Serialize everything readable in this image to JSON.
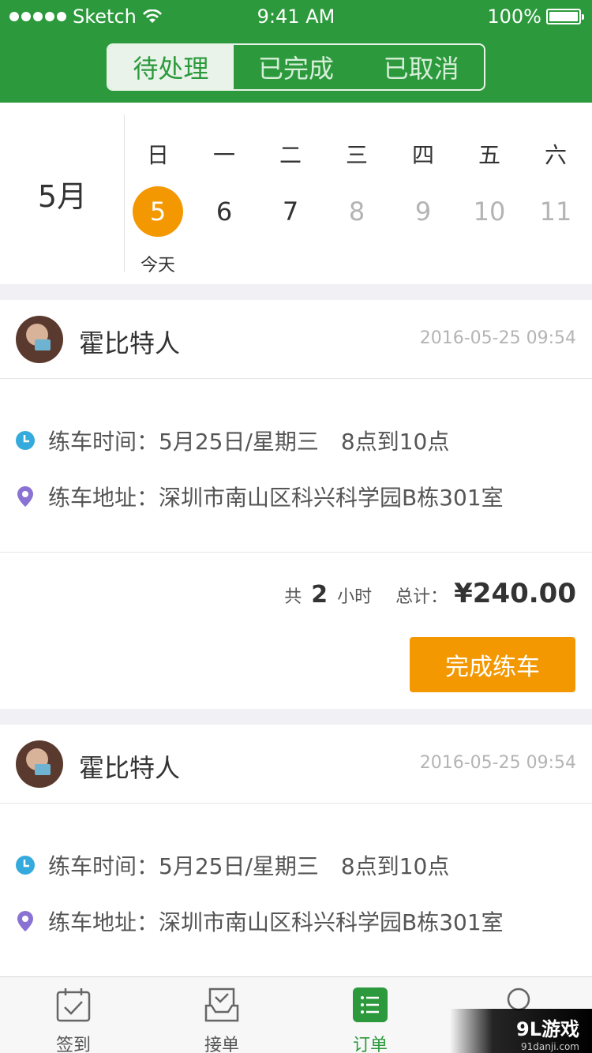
{
  "status_bar": {
    "carrier": "Sketch",
    "time": "9:41 AM",
    "battery": "100%"
  },
  "tabs": [
    {
      "label": "待处理",
      "active": true
    },
    {
      "label": "已完成",
      "active": false
    },
    {
      "label": "已取消",
      "active": false
    }
  ],
  "calendar": {
    "month": "5月",
    "weekdays": [
      "日",
      "一",
      "二",
      "三",
      "四",
      "五",
      "六"
    ],
    "dates": [
      "5",
      "6",
      "7",
      "8",
      "9",
      "10",
      "11"
    ],
    "today_label": "今天"
  },
  "orders": [
    {
      "name": "霍比特人",
      "datetime": "2016-05-25 09:54",
      "time_label": "练车时间：",
      "time_value": "5月25日/星期三　8点到10点",
      "address_label": "练车地址：",
      "address_value": "深圳市南山区科兴科学园B栋301室",
      "total_prefix": "共",
      "hours": "2",
      "hours_unit": "小时",
      "sum_label": "总计：",
      "price": "¥240.00",
      "action": "完成练车"
    },
    {
      "name": "霍比特人",
      "datetime": "2016-05-25 09:54",
      "time_label": "练车时间：",
      "time_value": "5月25日/星期三　8点到10点",
      "address_label": "练车地址：",
      "address_value": "深圳市南山区科兴科学园B栋301室"
    }
  ],
  "tabbar": [
    {
      "label": "签到",
      "icon": "calendar-check-icon"
    },
    {
      "label": "接单",
      "icon": "inbox-check-icon"
    },
    {
      "label": "订单",
      "icon": "list-icon",
      "active": true
    },
    {
      "label": "",
      "icon": "profile-icon"
    }
  ],
  "watermark": {
    "main": "9L游戏",
    "sub": "91danji.com"
  },
  "colors": {
    "brand_green": "#2c9a3c",
    "accent_orange": "#f39800",
    "clock_blue": "#35aadc",
    "pin_purple": "#8a72d4"
  }
}
